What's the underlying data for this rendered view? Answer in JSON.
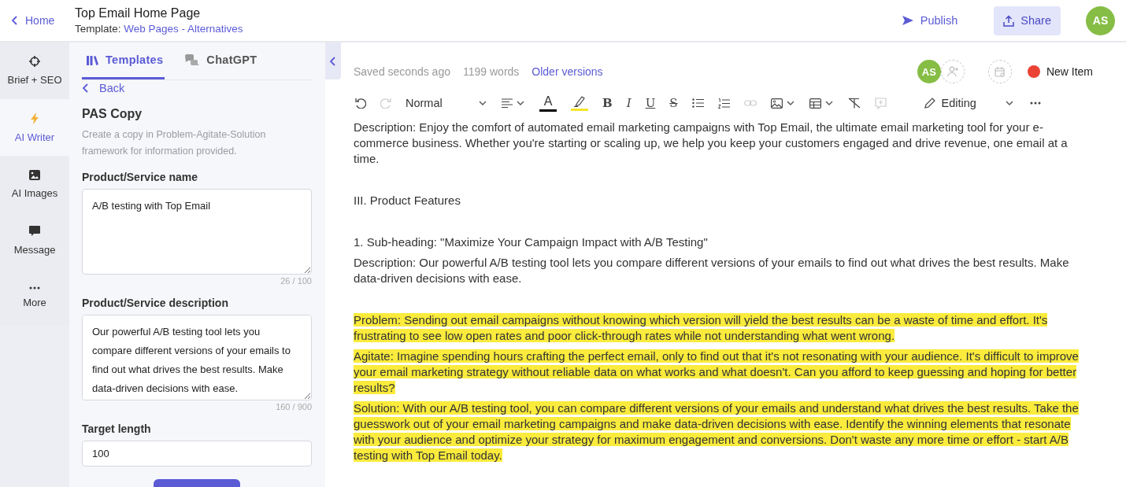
{
  "header": {
    "back": "Home",
    "title": "Top Email Home Page",
    "template_label": "Template:",
    "template_link": "Web Pages - Alternatives",
    "publish": "Publish",
    "share": "Share",
    "avatar": "AS"
  },
  "rail": [
    {
      "label": "Brief + SEO",
      "selected": false
    },
    {
      "label": "AI Writer",
      "selected": true
    },
    {
      "label": "AI Images",
      "selected": false
    },
    {
      "label": "Message",
      "selected": false
    },
    {
      "label": "More",
      "selected": false
    }
  ],
  "panel": {
    "tabs": [
      {
        "label": "Templates",
        "selected": true
      },
      {
        "label": "ChatGPT",
        "selected": false
      }
    ],
    "back": "Back",
    "title": "PAS Copy",
    "description": "Create a copy in Problem-Agitate-Solution framework for information provided.",
    "fields": [
      {
        "kind": "textarea",
        "label": "Product/Service name",
        "value": "A/B testing with Top Email",
        "counter": "26 / 100"
      },
      {
        "kind": "textarea",
        "label": "Product/Service description",
        "value": "Our powerful A/B testing tool lets you compare different versions of your emails to find out what drives the best results. Make data-driven decisions with ease.",
        "counter": "160 / 900"
      },
      {
        "kind": "input",
        "label": "Target length",
        "value": "100"
      }
    ]
  },
  "editor": {
    "saved": "Saved seconds ago",
    "words": "1199 words",
    "older_versions": "Older versions",
    "avatar": "AS",
    "status": {
      "label": "New Item",
      "color": "#ea4335"
    },
    "toolbar": {
      "style": "Normal",
      "text_color": "A",
      "marks": [
        "B",
        "I",
        "U",
        "S"
      ],
      "mode": "Editing"
    },
    "paragraphs": [
      {
        "kind": "body",
        "highlighted": false,
        "text": "Description: Enjoy the comfort of automated email marketing campaigns with Top Email, the ultimate email marketing tool for your e-commerce business. Whether you're starting or scaling up, we help you keep your customers engaged and drive revenue, one email at a time."
      },
      {
        "kind": "heading",
        "highlighted": false,
        "text": "III. Product Features"
      },
      {
        "kind": "heading",
        "highlighted": false,
        "text": "1. Sub-heading: \"Maximize Your Campaign Impact with A/B Testing\""
      },
      {
        "kind": "body",
        "highlighted": false,
        "text": "Description: Our powerful A/B testing tool lets you compare different versions of your emails to find out what drives the best results. Make data-driven decisions with ease."
      },
      {
        "kind": "body",
        "highlighted": true,
        "text": "Problem: Sending out email campaigns without knowing which version will yield the best results can be a waste of time and effort. It's frustrating to see low open rates and poor click-through rates while not understanding what went wrong."
      },
      {
        "kind": "body",
        "highlighted": true,
        "text": "Agitate: Imagine spending hours crafting the perfect email, only to find out that it's not resonating with your audience. It's difficult to improve your email marketing strategy without reliable data on what works and what doesn't. Can you afford to keep guessing and hoping for better results?"
      },
      {
        "kind": "body",
        "highlighted": true,
        "text": "Solution: With our A/B testing tool, you can compare different versions of your emails and understand what drives the best results. Take the guesswork out of your email marketing campaigns and make data-driven decisions with ease. Identify the winning elements that resonate with your audience and optimize your strategy for maximum engagement and conversions. Don't waste any more time or effort - start A/B testing with Top Email today."
      }
    ]
  }
}
